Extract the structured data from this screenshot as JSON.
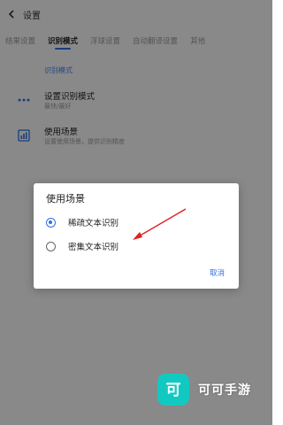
{
  "header": {
    "title": "设置"
  },
  "tabs": [
    {
      "label": "结果设置",
      "active": false
    },
    {
      "label": "识别模式",
      "active": true
    },
    {
      "label": "浮球设置",
      "active": false
    },
    {
      "label": "自动翻译设置",
      "active": false
    },
    {
      "label": "其他",
      "active": false
    }
  ],
  "section": {
    "label": "识别模式"
  },
  "rows": [
    {
      "title": "设置识别模式",
      "subtitle": "最快/最好",
      "icon": "dots-icon"
    },
    {
      "title": "使用场景",
      "subtitle": "设置使用场景，提供识别精度",
      "icon": "chart-icon"
    }
  ],
  "dialog": {
    "title": "使用场景",
    "options": [
      {
        "label": "稀疏文本识别",
        "selected": true
      },
      {
        "label": "密集文本识别",
        "selected": false
      }
    ],
    "cancel_label": "取消"
  },
  "watermark": {
    "text": "可可手游",
    "logo": "可"
  },
  "colors": {
    "accent": "#2f6fe4",
    "arrow": "#e02020",
    "watermark": "#12c9c2"
  }
}
